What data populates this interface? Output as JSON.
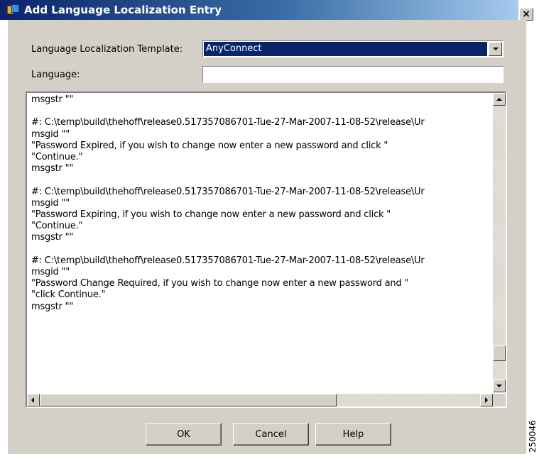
{
  "window": {
    "title": "Add Language Localization Entry",
    "close_label": "×"
  },
  "form": {
    "template_label": "Language Localization Template:",
    "template_value": "AnyConnect",
    "language_label": "Language:",
    "language_value": ""
  },
  "editor": {
    "lines": [
      "msgstr \"\"",
      "",
      "#: C:\\temp\\build\\thehoff\\release0.517357086701-Tue-27-Mar-2007-11-08-52\\release\\Ur",
      "msgid \"\"",
      "\"Password Expired, if you wish to change now enter a new password and click \"",
      "\"Continue.\"",
      "msgstr \"\"",
      "",
      "#: C:\\temp\\build\\thehoff\\release0.517357086701-Tue-27-Mar-2007-11-08-52\\release\\Ur",
      "msgid \"\"",
      "\"Password Expiring, if you wish to change now enter a new password and click \"",
      "\"Continue.\"",
      "msgstr \"\"",
      "",
      "#: C:\\temp\\build\\thehoff\\release0.517357086701-Tue-27-Mar-2007-11-08-52\\release\\Ur",
      "msgid \"\"",
      "\"Password Change Required, if you wish to change now enter a new password and \"",
      "\"click Continue.\"",
      "msgstr \"\""
    ]
  },
  "buttons": {
    "ok": "OK",
    "cancel": "Cancel",
    "help": "Help"
  },
  "figure_id": "250046",
  "colors": {
    "title_gradient_start": "#0a246a",
    "title_gradient_end": "#a6caf0",
    "dialog_bg": "#d4d0c8",
    "selection_bg": "#0a246a"
  }
}
